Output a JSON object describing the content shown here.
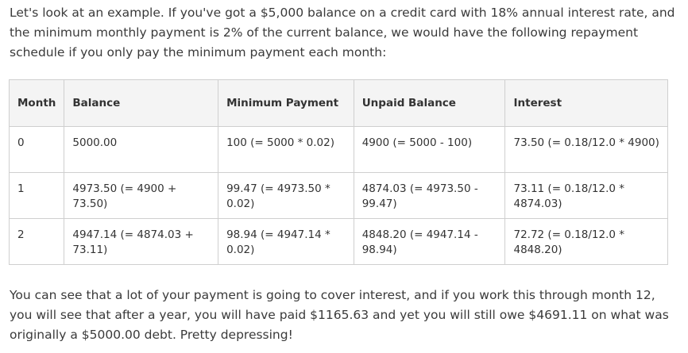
{
  "intro_text": "Let's look at an example. If you've got a $5,000 balance on a credit card with 18% annual interest rate, and the minimum monthly payment is 2% of the current balance, we would have the following repayment schedule if you only pay the minimum payment each month:",
  "table": {
    "headers": [
      "Month",
      "Balance",
      "Minimum Payment",
      "Unpaid Balance",
      "Interest"
    ],
    "rows": [
      [
        "0",
        "5000.00",
        "100 (= 5000 * 0.02)",
        "4900 (= 5000 - 100)",
        "73.50 (= 0.18/12.0 * 4900)"
      ],
      [
        "1",
        "4973.50 (= 4900 + 73.50)",
        "99.47 (= 4973.50 * 0.02)",
        "4874.03 (= 4973.50 - 99.47)",
        "73.11 (= 0.18/12.0 * 4874.03)"
      ],
      [
        "2",
        "4947.14 (= 4874.03 + 73.11)",
        "98.94 (= 4947.14 * 0.02)",
        "4848.20 (= 4947.14 - 98.94)",
        "72.72 (= 0.18/12.0 * 4848.20)"
      ]
    ]
  },
  "outro_text": "You can see that a lot of your payment is going to cover interest, and if you work this through month 12, you will see that after a year, you will have paid $1165.63 and yet you will still owe $4691.11 on what was originally a $5000.00 debt. Pretty depressing!"
}
